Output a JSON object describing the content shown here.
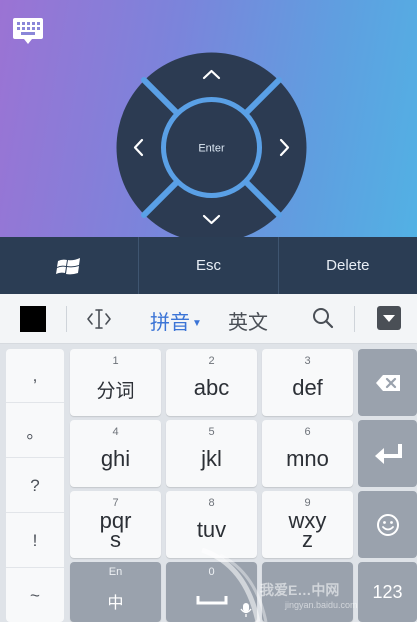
{
  "remote": {
    "dpad": {
      "center_label": "Enter"
    }
  },
  "actions": {
    "esc_label": "Esc",
    "delete_label": "Delete"
  },
  "ime": {
    "pinyin_label": "拼音",
    "english_label": "英文"
  },
  "punctuation": [
    ",",
    "。",
    "?",
    "!",
    "~"
  ],
  "keys": [
    {
      "num": "1",
      "label": "分词"
    },
    {
      "num": "2",
      "label": "abc"
    },
    {
      "num": "3",
      "label": "def"
    },
    {
      "num": "4",
      "label": "ghi"
    },
    {
      "num": "5",
      "label": "jkl"
    },
    {
      "num": "6",
      "label": "mno"
    },
    {
      "num": "7",
      "label": "pqr\ns"
    },
    {
      "num": "8",
      "label": "tuv"
    },
    {
      "num": "9",
      "label": "wxy\nz"
    }
  ],
  "bottom_row": {
    "lang_top": "En",
    "lang_main": "中",
    "space_num": "0",
    "num_label": "123"
  },
  "watermark": {
    "text": "我爱E…中网",
    "sub": "jingyan.baidu.com"
  },
  "colors": {
    "accent": "#3b74d6",
    "action_bar": "#2b3d54",
    "dpad": "#2c3b52"
  }
}
